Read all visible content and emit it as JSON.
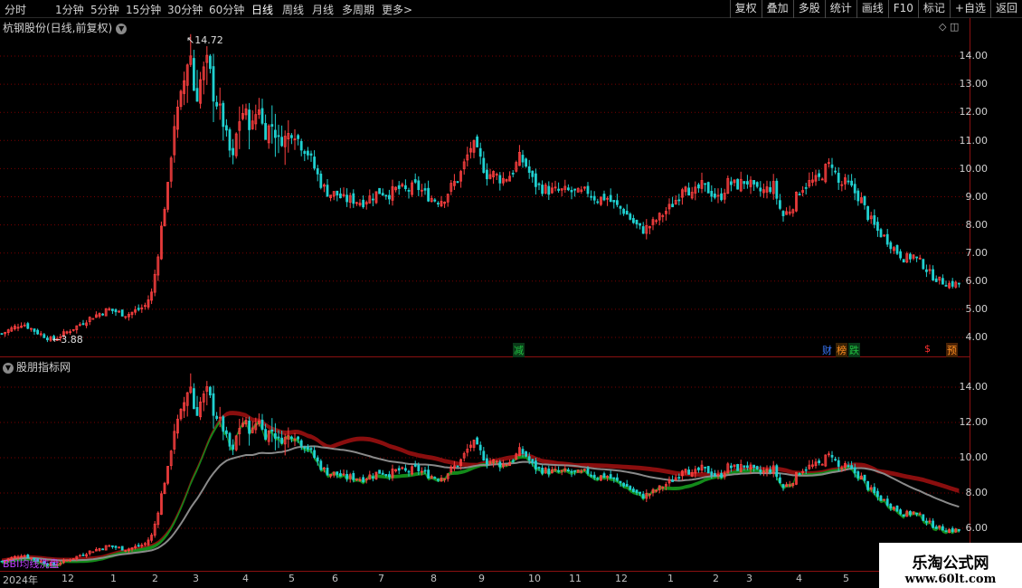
{
  "toolbar": {
    "timeframes": [
      "分时",
      "1分钟",
      "5分钟",
      "15分钟",
      "30分钟",
      "60分钟",
      "日线",
      "周线",
      "月线",
      "多周期",
      "更多"
    ],
    "active": "日线",
    "buttons": [
      "复权",
      "叠加",
      "多股",
      "统计",
      "画线",
      "F10",
      "标记",
      "+自选",
      "返回"
    ]
  },
  "main_pane": {
    "title": "杭钢股份(日线,前复权)",
    "y_labels": [
      "14.00",
      "13.00",
      "12.00",
      "11.00",
      "10.00",
      "9.00",
      "8.00",
      "7.00",
      "6.00",
      "5.00",
      "4.00"
    ],
    "high_label": "14.72",
    "low_label": "3.88",
    "signals": [
      {
        "text": "减",
        "color": "#20c040"
      },
      {
        "text": "财",
        "color": "#3a7aff"
      },
      {
        "text": "榜",
        "color": "#ff9020"
      },
      {
        "text": "跌",
        "color": "#20c040"
      },
      {
        "text": "$",
        "color": "#ff3030"
      },
      {
        "text": "预",
        "color": "#ff9020"
      }
    ]
  },
  "sub_pane": {
    "title": "股朋指标网",
    "y_labels": [
      "14.00",
      "12.00",
      "10.00",
      "8.00",
      "6.00"
    ],
    "indicator_name": "BBI均线洗盘"
  },
  "dates": [
    "2024年",
    "12",
    "1",
    "2",
    "3",
    "4",
    "5",
    "6",
    "7",
    "8",
    "9",
    "10",
    "11",
    "12",
    "1",
    "2",
    "3",
    "4",
    "5"
  ],
  "watermark": {
    "line1": "乐淘公式网",
    "line2": "www.60lt.com"
  },
  "colors": {
    "up": "#ff4040",
    "down": "#20d0d0",
    "grid": "#7a0000",
    "red_band": "#8a0e0e",
    "green_band": "#138a1a",
    "gray_line": "#8a8a8a"
  },
  "chart_data": {
    "type": "candlestick",
    "series_name": "杭钢股份",
    "adjustment": "前复权",
    "period": "日线",
    "y_range_main": [
      3.6,
      15
    ],
    "y_range_sub": [
      5.5,
      15.5
    ],
    "close_path": [
      [
        0,
        4.1
      ],
      [
        12,
        4.3
      ],
      [
        25,
        4.5
      ],
      [
        40,
        4.2
      ],
      [
        58,
        3.9
      ],
      [
        80,
        4.3
      ],
      [
        100,
        4.7
      ],
      [
        120,
        5
      ],
      [
        140,
        4.8
      ],
      [
        160,
        5.1
      ],
      [
        168,
        5.6
      ],
      [
        174,
        6.8
      ],
      [
        180,
        8.3
      ],
      [
        186,
        9.4
      ],
      [
        192,
        11.5
      ],
      [
        198,
        12.2
      ],
      [
        204,
        13.2
      ],
      [
        210,
        14.3
      ],
      [
        216,
        12.3
      ],
      [
        222,
        13.2
      ],
      [
        230,
        13.9
      ],
      [
        236,
        12.6
      ],
      [
        243,
        12.1
      ],
      [
        250,
        11.2
      ],
      [
        257,
        10.2
      ],
      [
        263,
        11.6
      ],
      [
        270,
        12.1
      ],
      [
        278,
        11.4
      ],
      [
        286,
        12.3
      ],
      [
        292,
        11.2
      ],
      [
        300,
        11.6
      ],
      [
        308,
        11
      ],
      [
        316,
        11.1
      ],
      [
        324,
        11.4
      ],
      [
        332,
        10.9
      ],
      [
        340,
        10.6
      ],
      [
        348,
        10
      ],
      [
        356,
        9.4
      ],
      [
        364,
        9.1
      ],
      [
        372,
        9.1
      ],
      [
        380,
        8.9
      ],
      [
        390,
        8.9
      ],
      [
        400,
        8.8
      ],
      [
        410,
        9
      ],
      [
        420,
        9.2
      ],
      [
        430,
        9.1
      ],
      [
        440,
        9.3
      ],
      [
        450,
        9.2
      ],
      [
        460,
        9.4
      ],
      [
        470,
        9.1
      ],
      [
        480,
        8.9
      ],
      [
        490,
        8.9
      ],
      [
        500,
        9.4
      ],
      [
        508,
        9.7
      ],
      [
        515,
        10.3
      ],
      [
        522,
        10.9
      ],
      [
        530,
        10.4
      ],
      [
        538,
        9.8
      ],
      [
        546,
        9.8
      ],
      [
        555,
        9.6
      ],
      [
        565,
        9.8
      ],
      [
        575,
        10.4
      ],
      [
        582,
        10.1
      ],
      [
        590,
        9.5
      ],
      [
        600,
        9.3
      ],
      [
        610,
        9.2
      ],
      [
        620,
        9.2
      ],
      [
        630,
        9.2
      ],
      [
        640,
        9.1
      ],
      [
        650,
        9.2
      ],
      [
        660,
        8.9
      ],
      [
        670,
        9
      ],
      [
        680,
        8.7
      ],
      [
        690,
        8.5
      ],
      [
        700,
        8.1
      ],
      [
        710,
        7.8
      ],
      [
        720,
        8
      ],
      [
        730,
        8.3
      ],
      [
        740,
        8.6
      ],
      [
        750,
        9
      ],
      [
        757,
        9.6
      ],
      [
        765,
        9
      ],
      [
        775,
        9.4
      ],
      [
        785,
        9.2
      ],
      [
        795,
        8.9
      ],
      [
        805,
        9.5
      ],
      [
        815,
        9.4
      ],
      [
        825,
        9.6
      ],
      [
        835,
        9.2
      ],
      [
        845,
        9.2
      ],
      [
        855,
        9.4
      ],
      [
        865,
        8.3
      ],
      [
        875,
        8.6
      ],
      [
        885,
        9.3
      ],
      [
        895,
        9.5
      ],
      [
        905,
        9.6
      ],
      [
        913,
        10
      ],
      [
        920,
        10.2
      ],
      [
        928,
        9.4
      ],
      [
        936,
        9.5
      ],
      [
        944,
        9.2
      ],
      [
        952,
        8.9
      ],
      [
        960,
        8.3
      ],
      [
        970,
        7.8
      ],
      [
        980,
        7.5
      ],
      [
        990,
        7.1
      ],
      [
        1000,
        6.8
      ],
      [
        1010,
        6.9
      ],
      [
        1020,
        6.6
      ],
      [
        1030,
        6.2
      ],
      [
        1040,
        6
      ],
      [
        1050,
        5.9
      ],
      [
        1062,
        5.9
      ]
    ]
  }
}
